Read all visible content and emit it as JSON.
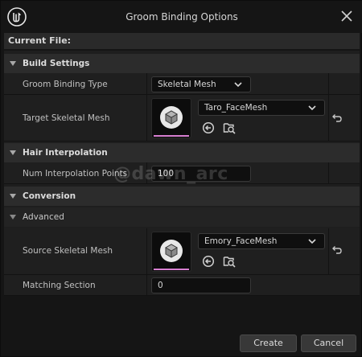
{
  "window": {
    "title": "Groom Binding Options",
    "current_file_label": "Current File:"
  },
  "sections": {
    "build_settings": "Build Settings",
    "hair_interpolation": "Hair Interpolation",
    "conversion": "Conversion",
    "advanced": "Advanced"
  },
  "properties": {
    "groom_binding_type": {
      "label": "Groom Binding Type",
      "value": "Skeletal Mesh"
    },
    "target_skeletal_mesh": {
      "label": "Target Skeletal Mesh",
      "value": "Taro_FaceMesh"
    },
    "num_interpolation_points": {
      "label": "Num Interpolation Points",
      "value": "100"
    },
    "source_skeletal_mesh": {
      "label": "Source Skeletal Mesh",
      "value": "Emory_FaceMesh"
    },
    "matching_section": {
      "label": "Matching Section",
      "value": "0"
    }
  },
  "buttons": {
    "create": "Create",
    "cancel": "Cancel"
  },
  "watermark": "@dawn_arc",
  "colors": {
    "thumbnail_accent": "#d77fd1"
  },
  "icons": [
    "unreal-logo-icon",
    "close-icon",
    "chevron-down-icon",
    "cube-icon",
    "use-selected-icon",
    "browse-icon",
    "reset-icon"
  ]
}
